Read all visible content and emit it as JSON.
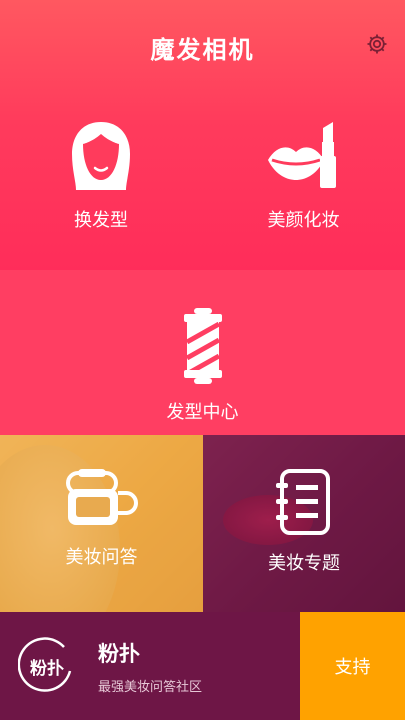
{
  "header": {
    "title": "魔发相机"
  },
  "tiles": {
    "change_hair": {
      "label": "换发型",
      "icon": "woman-hair-icon"
    },
    "makeup": {
      "label": "美颜化妆",
      "icon": "lips-lipstick-icon"
    },
    "hair_center": {
      "label": "发型中心",
      "icon": "barber-pole-icon"
    },
    "makeup_qa": {
      "label": "美妆问答",
      "icon": "chat-bubbles-icon"
    },
    "makeup_topics": {
      "label": "美妆专题",
      "icon": "notebook-icon"
    }
  },
  "promo": {
    "logo_text": "粉扑",
    "title": "粉扑",
    "subtitle": "最强美妆问答社区"
  },
  "support": {
    "label": "支持"
  },
  "colors": {
    "primary": "#ff3b5c",
    "promo_bg": "#6e1646",
    "support_bg": "#ffa200"
  }
}
